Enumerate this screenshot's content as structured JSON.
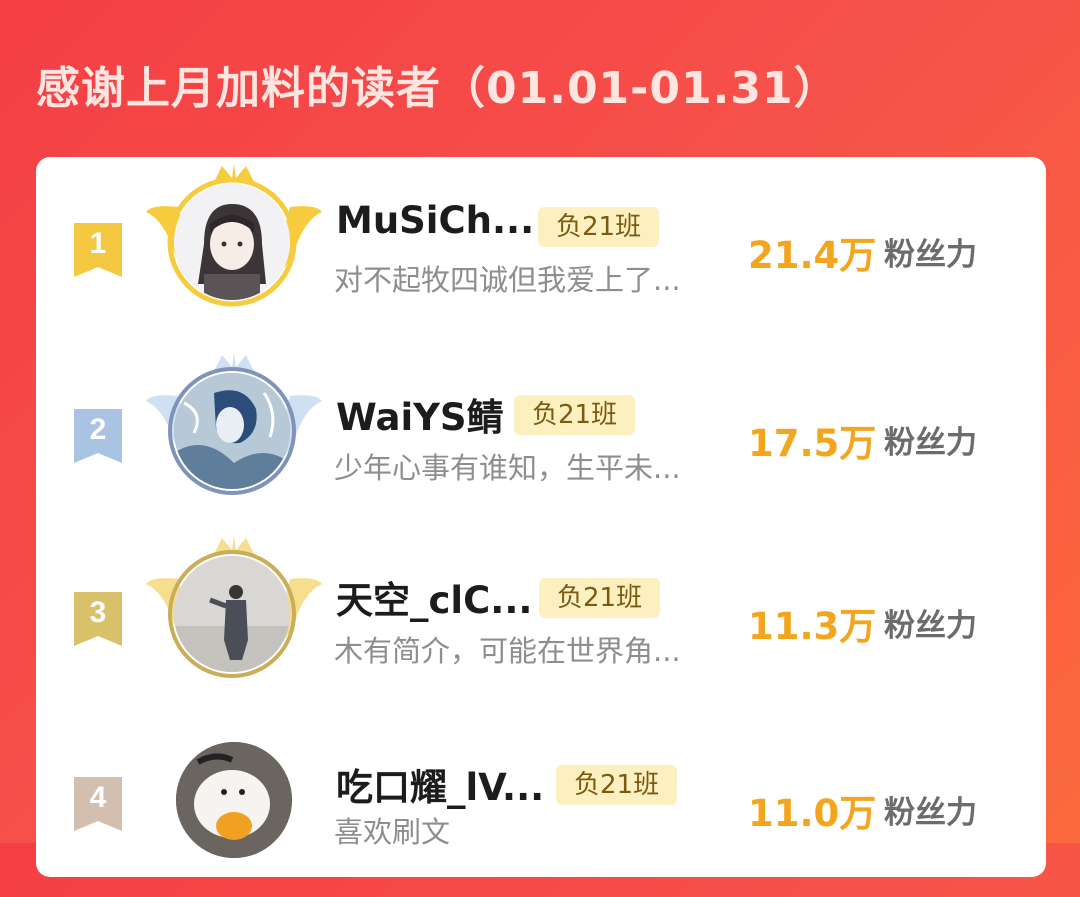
{
  "title": "感谢上月加料的读者（01.01-01.31）",
  "colors": {
    "background_start": "#f43f45",
    "background_end": "#fb6a3c",
    "gold": "#f3a51e",
    "badge_bg": "#fdf0c0"
  },
  "readers": [
    {
      "rank": "1",
      "name": "MuSiCh...",
      "badge": "负21班",
      "bio": "对不起牧四诚但我爱上了...",
      "fans_value": "21.4万",
      "fans_label": "粉丝力",
      "medal": "gold"
    },
    {
      "rank": "2",
      "name": "WaiYS鲭",
      "badge": "负21班",
      "bio": "少年心事有谁知，生平未...",
      "fans_value": "17.5万",
      "fans_label": "粉丝力",
      "medal": "silver"
    },
    {
      "rank": "3",
      "name": "天空_clC...",
      "badge": "负21班",
      "bio": "木有简介，可能在世界角...",
      "fans_value": "11.3万",
      "fans_label": "粉丝力",
      "medal": "bronze"
    },
    {
      "rank": "4",
      "name": "吃口耀_lV...",
      "badge": "负21班",
      "bio": "喜欢刷文",
      "fans_value": "11.0万",
      "fans_label": "粉丝力",
      "medal": "none"
    }
  ]
}
